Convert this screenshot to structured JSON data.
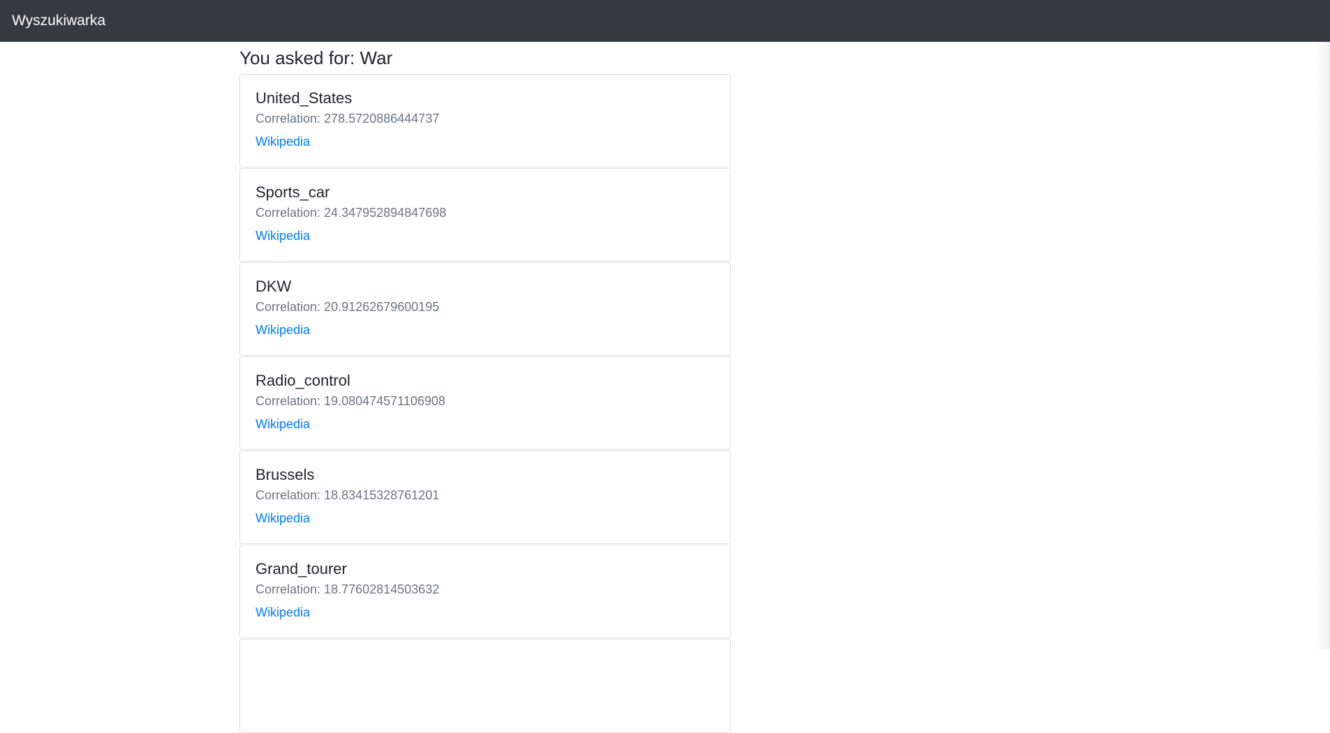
{
  "navbar": {
    "brand": "Wyszukiwarka"
  },
  "query": {
    "heading": "You asked for: War"
  },
  "results": [
    {
      "title": "United_States",
      "correlation": "Correlation: 278.5720886444737",
      "link": "Wikipedia"
    },
    {
      "title": "Sports_car",
      "correlation": "Correlation: 24.347952894847698",
      "link": "Wikipedia"
    },
    {
      "title": "DKW",
      "correlation": "Correlation: 20.91262679600195",
      "link": "Wikipedia"
    },
    {
      "title": "Radio_control",
      "correlation": "Correlation: 19.080474571106908",
      "link": "Wikipedia"
    },
    {
      "title": "Brussels",
      "correlation": "Correlation: 18.83415328761201",
      "link": "Wikipedia"
    },
    {
      "title": "Grand_tourer",
      "correlation": "Correlation: 18.77602814503632",
      "link": "Wikipedia"
    }
  ]
}
